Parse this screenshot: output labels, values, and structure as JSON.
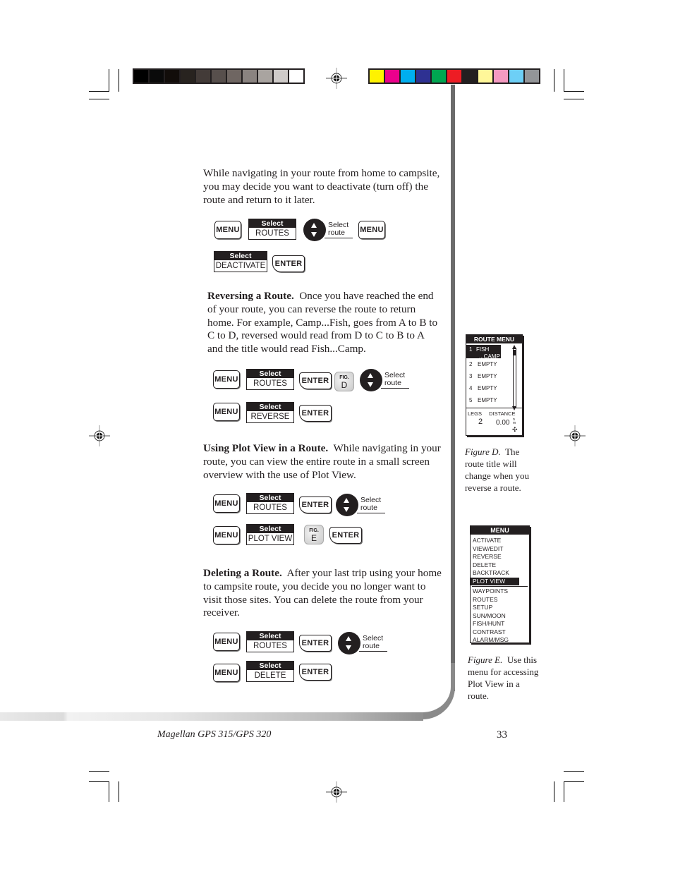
{
  "print_marks": {
    "gray_swatches": [
      "#000000",
      "#0a0a0a",
      "#120d0a",
      "#28231f",
      "#433b38",
      "#574f4c",
      "#6f6662",
      "#8a8380",
      "#a9a4a0",
      "#cfcbc9",
      "#ffffff"
    ],
    "color_swatches": [
      "#fff200",
      "#ec008c",
      "#00aeef",
      "#2e3192",
      "#00a651",
      "#ed1c24",
      "#231f20",
      "#fff799",
      "#f49ac1",
      "#6dcff6",
      "#939598"
    ]
  },
  "intro": {
    "text": "While navigating in your route from home to campsite, you may decide you want to deactivate (turn off) the route and return to it later."
  },
  "sequences": {
    "deactivate": {
      "row1": {
        "menu1": "MENU",
        "select_hdr": "Select",
        "select_val": "ROUTES",
        "rocker_label_1": "Select",
        "rocker_label_2": "route",
        "menu2": "MENU"
      },
      "row2": {
        "select_hdr": "Select",
        "select_val": "DEACTIVATE",
        "enter": "ENTER"
      }
    },
    "reverse": {
      "row1": {
        "menu": "MENU",
        "select_hdr": "Select",
        "select_val": "ROUTES",
        "enter": "ENTER",
        "fig_tag": "FIG.",
        "fig_letter": "D",
        "rocker_label_1": "Select",
        "rocker_label_2": "route"
      },
      "row2": {
        "menu": "MENU",
        "select_hdr": "Select",
        "select_val": "REVERSE",
        "enter": "ENTER"
      }
    },
    "plot_view": {
      "row1": {
        "menu": "MENU",
        "select_hdr": "Select",
        "select_val": "ROUTES",
        "enter": "ENTER",
        "rocker_label_1": "Select",
        "rocker_label_2": "route"
      },
      "row2": {
        "menu": "MENU",
        "select_hdr": "Select",
        "select_val": "PLOT VIEW",
        "fig_tag": "FIG.",
        "fig_letter": "E",
        "enter": "ENTER"
      }
    },
    "delete": {
      "row1": {
        "menu": "MENU",
        "select_hdr": "Select",
        "select_val": "ROUTES",
        "enter": "ENTER",
        "rocker_label_1": "Select",
        "rocker_label_2": "route"
      },
      "row2": {
        "menu": "MENU",
        "select_hdr": "Select",
        "select_val": "DELETE",
        "enter": "ENTER"
      }
    }
  },
  "sections": {
    "reversing": {
      "heading": "Reversing a Route.",
      "body": "Once you have reached the end of your route, you can reverse the route to return home.  For example, Camp...Fish, goes from A to B to C to D, reversed would read from D to C to B to A and the title would read Fish...Camp."
    },
    "plot_view": {
      "heading": "Using Plot View in a Route.",
      "body": "While navigating in your route, you can view the entire route in a small screen overview with the use of Plot View."
    },
    "deleting": {
      "heading": "Deleting a Route.",
      "body": "After your last trip using your home to campsite route, you decide you no longer want to visit those sites.  You can delete the route from your receiver."
    }
  },
  "figure_d": {
    "screen_title": "ROUTE MENU",
    "routes": [
      {
        "num": "1",
        "name": "FISH",
        "name2": "...CAMP",
        "selected": true
      },
      {
        "num": "2",
        "name": "EMPTY"
      },
      {
        "num": "3",
        "name": "EMPTY"
      },
      {
        "num": "4",
        "name": "EMPTY"
      },
      {
        "num": "5",
        "name": "EMPTY"
      }
    ],
    "legs_label": "LEGS",
    "distance_label": "DISTANCE",
    "legs_value": "2",
    "distance_value": "0.00",
    "distance_unit_top": "n",
    "distance_unit_bottom": "m",
    "caption_label": "Figure D.",
    "caption_text": "The route title will change when you reverse a route."
  },
  "figure_e": {
    "screen_title": "MENU",
    "items_top": [
      "ACTIVATE",
      "VIEW/EDIT",
      "REVERSE",
      "DELETE",
      "BACKTRACK",
      "PLOT VIEW"
    ],
    "selected_item": "PLOT VIEW",
    "items_bottom": [
      "WAYPOINTS",
      "ROUTES",
      "SETUP",
      "SUN/MOON",
      "FISH/HUNT",
      "CONTRAST",
      "ALARM/MSG"
    ],
    "caption_label": "Figure E.",
    "caption_text": "Use this menu for accessing Plot View in a route."
  },
  "footer": {
    "product": "Magellan GPS 315/GPS 320",
    "page_number": "33"
  }
}
